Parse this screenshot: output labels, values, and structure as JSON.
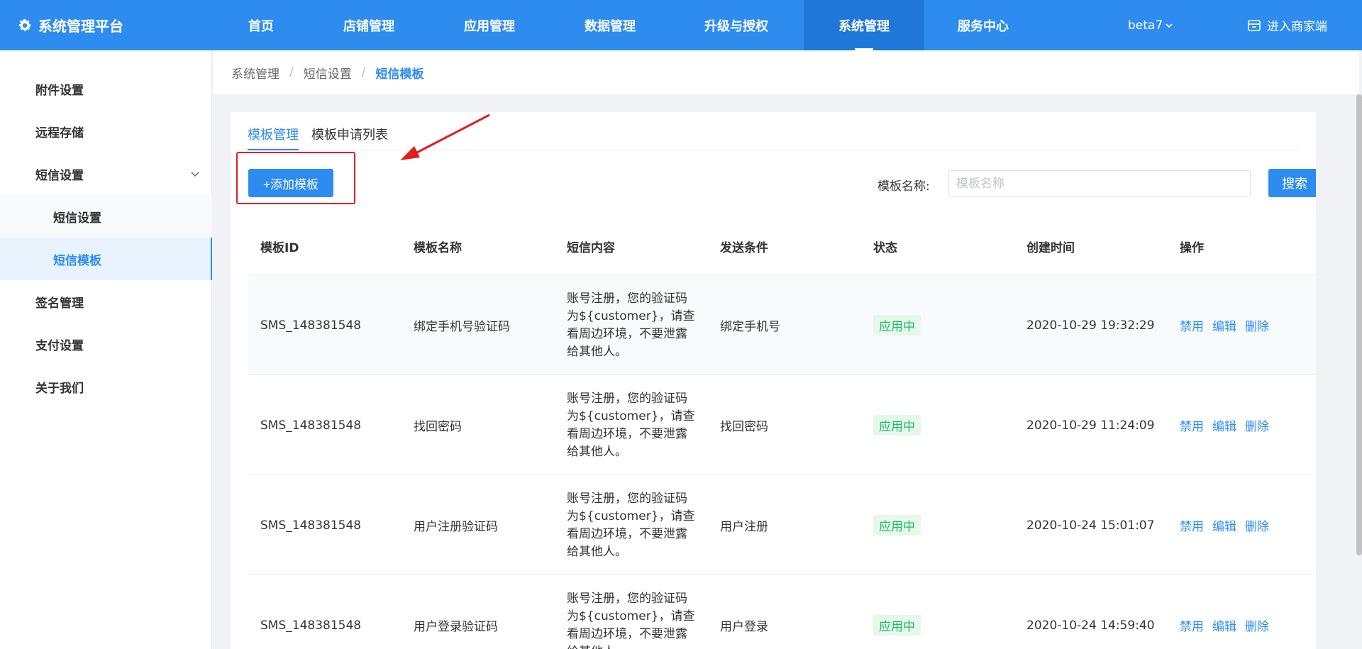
{
  "brand": {
    "title": "系统管理平台",
    "icon": "gear-icon"
  },
  "nav": {
    "items": [
      {
        "label": "首页"
      },
      {
        "label": "店铺管理"
      },
      {
        "label": "应用管理"
      },
      {
        "label": "数据管理"
      },
      {
        "label": "升级与授权"
      },
      {
        "label": "系统管理",
        "active": true
      },
      {
        "label": "服务中心"
      }
    ],
    "user": "beta7",
    "enter_merchant": "进入商家端"
  },
  "sidebar": {
    "items": [
      {
        "label": "附件设置"
      },
      {
        "label": "远程存储"
      },
      {
        "label": "短信设置",
        "expanded": true
      },
      {
        "label": "短信设置",
        "sub": true
      },
      {
        "label": "短信模板",
        "sub": true,
        "active": true
      },
      {
        "label": "签名管理"
      },
      {
        "label": "支付设置"
      },
      {
        "label": "关于我们"
      }
    ]
  },
  "breadcrumb": [
    "系统管理",
    "短信设置",
    "短信模板"
  ],
  "tabs": [
    {
      "label": "模板管理",
      "active": true
    },
    {
      "label": "模板申请列表"
    }
  ],
  "toolbar": {
    "add_label": "+添加模板",
    "search_label": "模板名称:",
    "search_placeholder": "模板名称",
    "search_button": "搜索"
  },
  "table": {
    "columns": [
      "模板ID",
      "模板名称",
      "短信内容",
      "发送条件",
      "状态",
      "创建时间",
      "操作"
    ],
    "rows": [
      {
        "id": "SMS_148381548",
        "name": "绑定手机号验证码",
        "content": "账号注册，您的验证码为${customer}，请查看周边环境，不要泄露给其他人。",
        "condition": "绑定手机号",
        "status": "应用中",
        "created": "2020-10-29 19:32:29"
      },
      {
        "id": "SMS_148381548",
        "name": "找回密码",
        "content": "账号注册，您的验证码为${customer}，请查看周边环境，不要泄露给其他人。",
        "condition": "找回密码",
        "status": "应用中",
        "created": "2020-10-29 11:24:09"
      },
      {
        "id": "SMS_148381548",
        "name": "用户注册验证码",
        "content": "账号注册，您的验证码为${customer}，请查看周边环境，不要泄露给其他人。",
        "condition": "用户注册",
        "status": "应用中",
        "created": "2020-10-24 15:01:07"
      },
      {
        "id": "SMS_148381548",
        "name": "用户登录验证码",
        "content": "账号注册，您的验证码为${customer}，请查看周边环境，不要泄露给其他人。",
        "condition": "用户登录",
        "status": "应用中",
        "created": "2020-10-24 14:59:40"
      }
    ],
    "actions": [
      "禁用",
      "编辑",
      "删除"
    ]
  },
  "colors": {
    "primary": "#2e8cf0",
    "success": "#19be6b",
    "highlight": "#e02020"
  }
}
